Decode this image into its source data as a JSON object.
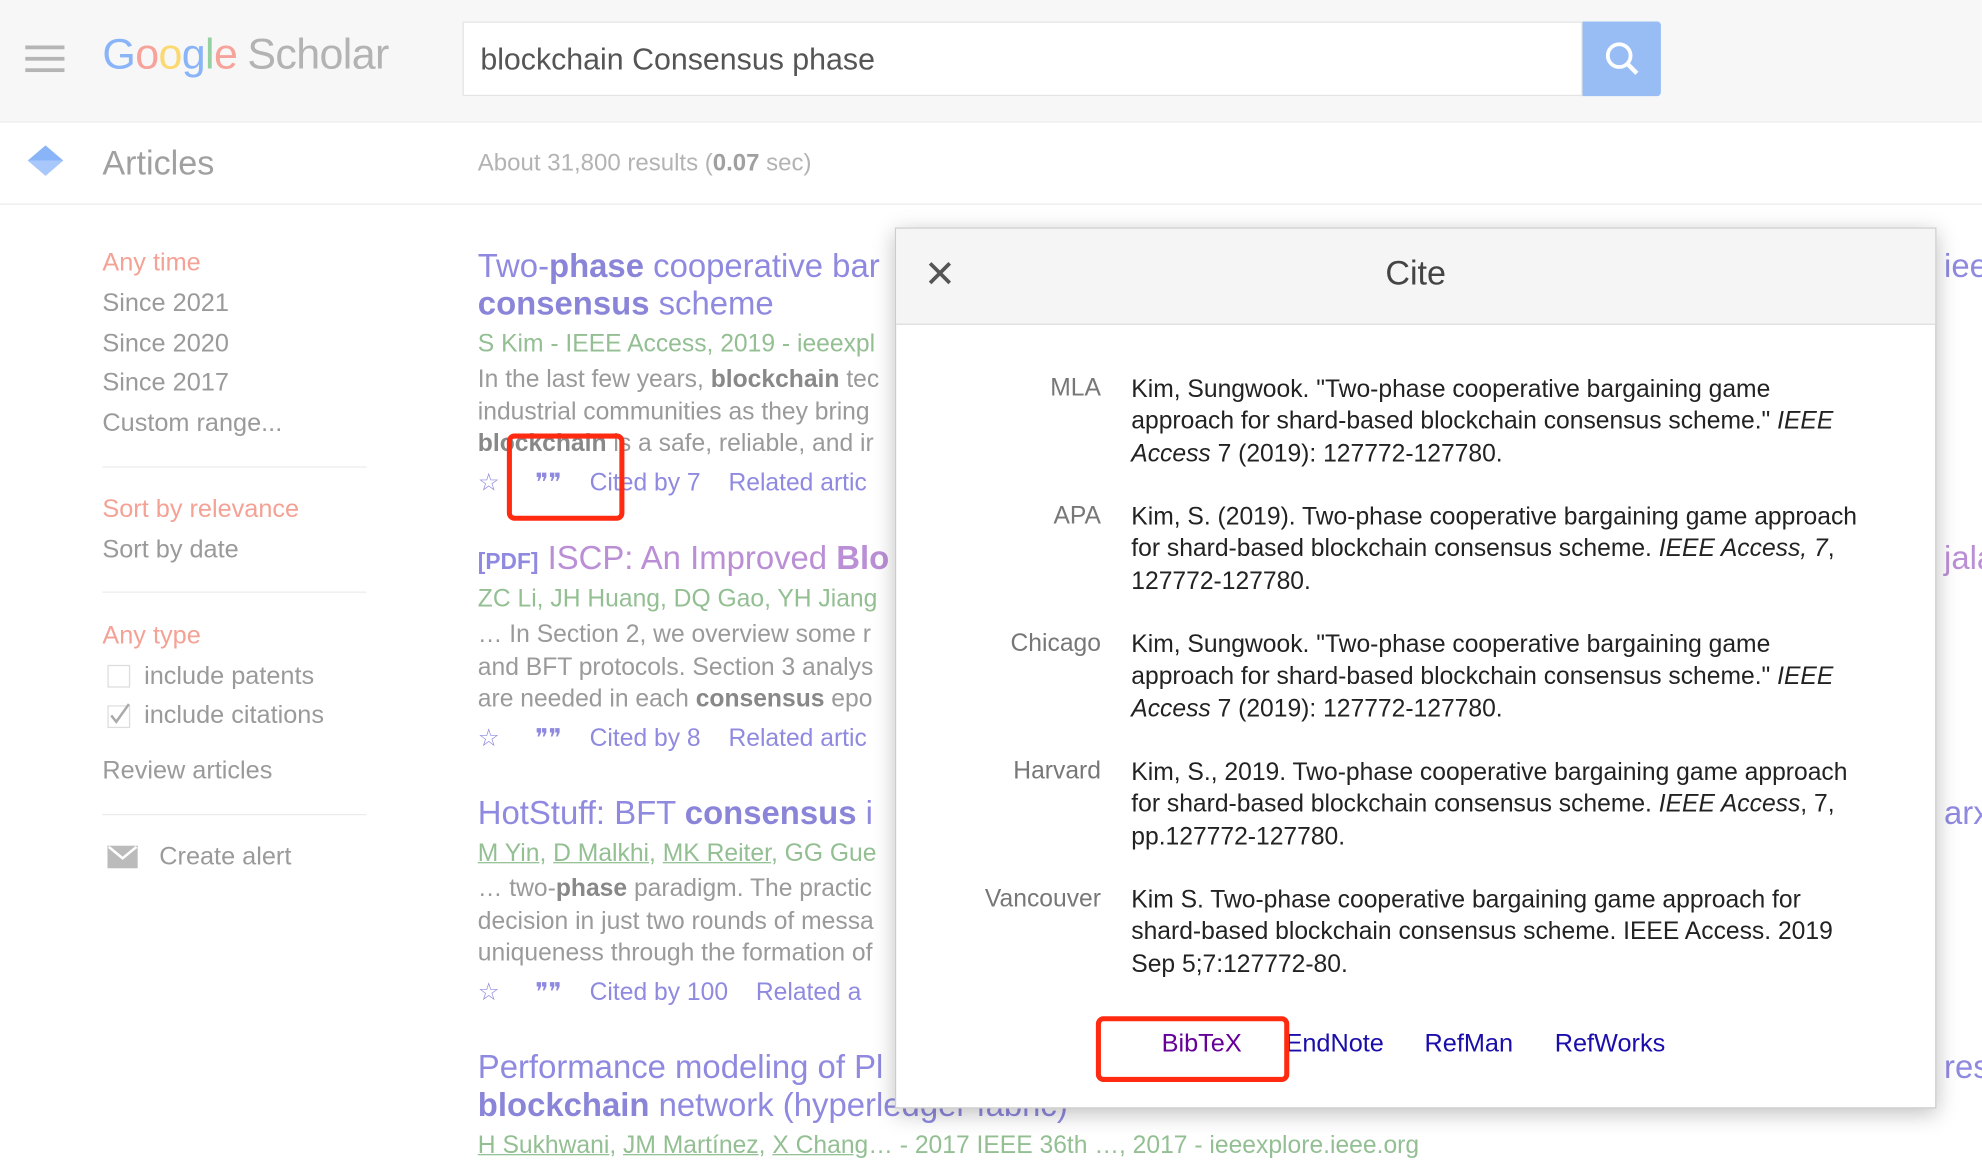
{
  "header": {
    "logo_google": "Google",
    "logo_scholar": "Scholar",
    "search_value": "blockchain Consensus phase",
    "search_icon": "search-icon",
    "menu_icon": "hamburger-icon"
  },
  "subbar": {
    "section": "Articles",
    "results_prefix": "About 31,800 results (",
    "results_time": "0.07",
    "results_suffix": " sec)"
  },
  "sidebar": {
    "time": [
      "Any time",
      "Since 2021",
      "Since 2020",
      "Since 2017",
      "Custom range..."
    ],
    "sort": [
      "Sort by relevance",
      "Sort by date"
    ],
    "type_heading": "Any type",
    "include_patents": {
      "label": "include patents",
      "checked": false
    },
    "include_citations": {
      "label": "include citations",
      "checked": true
    },
    "review": "Review articles",
    "create_alert": "Create alert"
  },
  "results": [
    {
      "title_parts": [
        "Two-",
        "phase",
        " cooperative bar"
      ],
      "title_line2": [
        "consensus",
        " scheme"
      ],
      "meta": "S Kim - IEEE Access, 2019 - ieeexpl",
      "snippet": [
        [
          "In the last few years, ",
          "blockchain",
          " tec"
        ],
        [
          "industrial communities as they bring",
          "",
          " "
        ],
        [
          "",
          "blockchain",
          " is a safe, reliable, and ir"
        ]
      ],
      "cited": "Cited by 7",
      "related": "Related artic",
      "right": "iee"
    },
    {
      "tag": "[PDF]",
      "title": "ISCP: An Improved ",
      "title_bold": "Blo",
      "meta": "ZC Li, JH Huang, DQ Gao, YH Jiang",
      "snippet": [
        [
          "… In Section 2, we overview some r",
          "",
          ""
        ],
        [
          "and BFT protocols. Section 3 analys",
          "",
          ""
        ],
        [
          "are needed in each ",
          "consensus",
          " epo"
        ]
      ],
      "cited": "Cited by 8",
      "related": "Related artic",
      "right": "jala"
    },
    {
      "title": "HotStuff: BFT ",
      "title_bold": "consensus",
      " title_end": " i",
      "authors": [
        "M Yin",
        "D Malkhi",
        "MK Reiter",
        "GG Gue"
      ],
      "snippet": [
        [
          "… two-",
          "phase",
          " paradigm. The practic"
        ],
        [
          "decision in just two rounds of messa",
          "",
          ""
        ],
        [
          "uniqueness through the formation of",
          "",
          ""
        ]
      ],
      "cited": "Cited by 100",
      "related": "Related a",
      "right": "arx"
    },
    {
      "title": "Performance modeling of Pl",
      "title_line2_bold": "blockchain",
      "title_line2": " network (hyperledger fabric)",
      "authors": [
        "H Sukhwani",
        "JM Martínez",
        "X Chang"
      ],
      "meta_tail": "… - 2017 IEEE 36th …, 2017 - ieeexplore.ieee.org",
      "right": "res"
    }
  ],
  "cite_dialog": {
    "title": "Cite",
    "close_icon": "close-icon",
    "entries": [
      {
        "format": "MLA",
        "pre": "Kim, Sungwook. \"Two-phase cooperative bargaining game approach for shard-based blockchain consensus scheme.\" ",
        "journal": "IEEE Access",
        "post": " 7 (2019): 127772-127780."
      },
      {
        "format": "APA",
        "pre": "Kim, S. (2019). Two-phase cooperative bargaining game approach for shard-based blockchain consensus scheme. ",
        "journal": "IEEE Access, 7",
        "post": ", 127772-127780."
      },
      {
        "format": "Chicago",
        "pre": "Kim, Sungwook. \"Two-phase cooperative bargaining game approach for shard-based blockchain consensus scheme.\" ",
        "journal": "IEEE Access",
        "post": " 7 (2019): 127772-127780."
      },
      {
        "format": "Harvard",
        "pre": "Kim, S., 2019. Two-phase cooperative bargaining game approach for shard-based blockchain consensus scheme. ",
        "journal": "IEEE Access",
        "post": ", 7, pp.127772-127780."
      },
      {
        "format": "Vancouver",
        "pre": "Kim S. Two-phase cooperative bargaining game approach for shard-based blockchain consensus scheme. IEEE Access. 2019 Sep 5;7:127772-80.",
        "journal": "",
        "post": ""
      }
    ],
    "exports": [
      "BibTeX",
      "EndNote",
      "RefMan",
      "RefWorks"
    ]
  },
  "colors": {
    "highlight_box": "#ff2a10",
    "link": "#1a0dab",
    "visited": "#660099"
  }
}
